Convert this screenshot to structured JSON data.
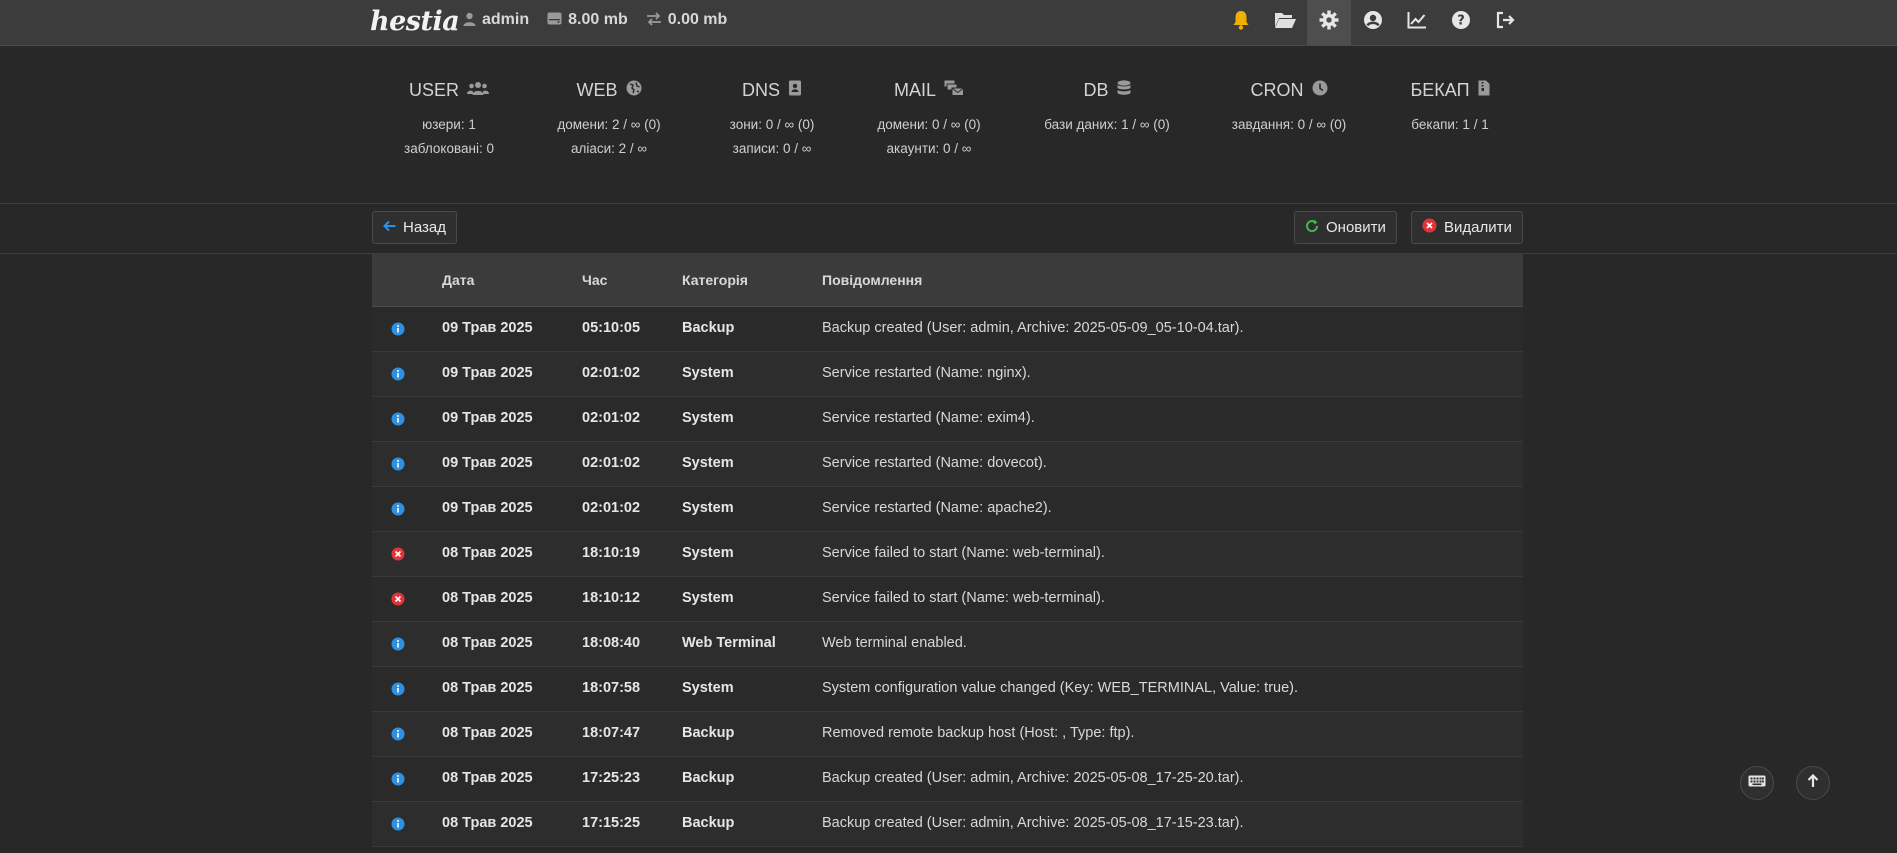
{
  "topbar": {
    "logo": "hestia",
    "user": "admin",
    "disk": "8.00 mb",
    "bandwidth": "0.00 mb",
    "icons": [
      "bell-icon",
      "folder-open-icon",
      "gear-icon",
      "user-circle-icon",
      "chart-line-icon",
      "question-icon",
      "logout-icon"
    ],
    "bell_color": "#f0b000"
  },
  "stats": [
    {
      "title": "USER",
      "icon": "users-icon",
      "lines": [
        "юзери: 1",
        "заблоковані: 0"
      ]
    },
    {
      "title": "WEB",
      "icon": "globe-icon",
      "lines": [
        "домени: 2 / ∞ (0)",
        "аліаси: 2 / ∞"
      ]
    },
    {
      "title": "DNS",
      "icon": "address-book-icon",
      "lines": [
        "зони: 0 / ∞ (0)",
        "записи: 0 / ∞"
      ]
    },
    {
      "title": "MAIL",
      "icon": "mail-bulk-icon",
      "lines": [
        "домени: 0 / ∞ (0)",
        "акаунти: 0 / ∞"
      ]
    },
    {
      "title": "DB",
      "icon": "database-icon",
      "lines": [
        "бази даних: 1 / ∞ (0)"
      ]
    },
    {
      "title": "CRON",
      "icon": "clock-icon",
      "lines": [
        "завдання: 0 / ∞ (0)"
      ]
    },
    {
      "title": "БЕКАП",
      "icon": "file-archive-icon",
      "lines": [
        "бекапи: 1 / 1"
      ]
    }
  ],
  "toolbar": {
    "back_label": "Назад",
    "refresh_label": "Оновити",
    "delete_label": "Видалити"
  },
  "table": {
    "headers": [
      "Дата",
      "Час",
      "Категорія",
      "Повідомлення"
    ],
    "rows": [
      {
        "level": "info",
        "date": "09 Трав 2025",
        "time": "05:10:05",
        "category": "Backup",
        "message": "Backup created (User: admin, Archive: 2025-05-09_05-10-04.tar)."
      },
      {
        "level": "info",
        "date": "09 Трав 2025",
        "time": "02:01:02",
        "category": "System",
        "message": "Service restarted (Name: nginx)."
      },
      {
        "level": "info",
        "date": "09 Трав 2025",
        "time": "02:01:02",
        "category": "System",
        "message": "Service restarted (Name: exim4)."
      },
      {
        "level": "info",
        "date": "09 Трав 2025",
        "time": "02:01:02",
        "category": "System",
        "message": "Service restarted (Name: dovecot)."
      },
      {
        "level": "info",
        "date": "09 Трав 2025",
        "time": "02:01:02",
        "category": "System",
        "message": "Service restarted (Name: apache2)."
      },
      {
        "level": "error",
        "date": "08 Трав 2025",
        "time": "18:10:19",
        "category": "System",
        "message": "Service failed to start (Name: web-terminal)."
      },
      {
        "level": "error",
        "date": "08 Трав 2025",
        "time": "18:10:12",
        "category": "System",
        "message": "Service failed to start (Name: web-terminal)."
      },
      {
        "level": "info",
        "date": "08 Трав 2025",
        "time": "18:08:40",
        "category": "Web Terminal",
        "message": "Web terminal enabled."
      },
      {
        "level": "info",
        "date": "08 Трав 2025",
        "time": "18:07:58",
        "category": "System",
        "message": "System configuration value changed (Key: WEB_TERMINAL, Value: true)."
      },
      {
        "level": "info",
        "date": "08 Трав 2025",
        "time": "18:07:47",
        "category": "Backup",
        "message": "Removed remote backup host (Host: , Type: ftp)."
      },
      {
        "level": "info",
        "date": "08 Трав 2025",
        "time": "17:25:23",
        "category": "Backup",
        "message": "Backup created (User: admin, Archive: 2025-05-08_17-25-20.tar)."
      },
      {
        "level": "info",
        "date": "08 Трав 2025",
        "time": "17:15:25",
        "category": "Backup",
        "message": "Backup created (User: admin, Archive: 2025-05-08_17-15-23.tar)."
      }
    ]
  },
  "colors": {
    "info": "#2f8fe0",
    "error": "#e0343a",
    "refresh": "#3fb950",
    "back": "#2f8fe0"
  },
  "floating": [
    "keyboard-icon",
    "arrow-up-icon"
  ]
}
